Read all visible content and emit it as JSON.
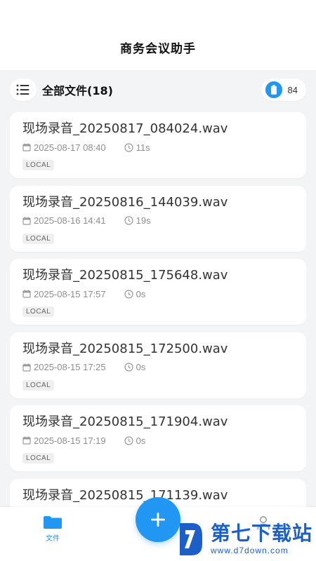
{
  "header": {
    "title": "商务会议助手"
  },
  "toolbar": {
    "menu_icon": "list-icon",
    "heading": "全部文件(18)",
    "battery_icon": "battery-icon",
    "battery_value": "84",
    "accent": "#2196f3"
  },
  "recordings": [
    {
      "name": "现场录音_20250817_084024.wav",
      "date": "2025-08-17 08:40",
      "duration": "11s",
      "tag": "LOCAL"
    },
    {
      "name": "现场录音_20250816_144039.wav",
      "date": "2025-08-16 14:41",
      "duration": "19s",
      "tag": "LOCAL"
    },
    {
      "name": "现场录音_20250815_175648.wav",
      "date": "2025-08-15 17:57",
      "duration": "0s",
      "tag": "LOCAL"
    },
    {
      "name": "现场录音_20250815_172500.wav",
      "date": "2025-08-15 17:25",
      "duration": "0s",
      "tag": "LOCAL"
    },
    {
      "name": "现场录音_20250815_171904.wav",
      "date": "2025-08-15 17:19",
      "duration": "0s",
      "tag": "LOCAL"
    },
    {
      "name": "现场录音_20250815_171139.wav",
      "date": "",
      "duration": "",
      "tag": ""
    }
  ],
  "bottom_nav": {
    "files_label": "文件",
    "files_icon": "folder-icon",
    "mine_icon": "person-icon",
    "add_icon": "plus-icon"
  },
  "watermark": {
    "name": "第七下载站",
    "url": "www.d7down.com"
  }
}
